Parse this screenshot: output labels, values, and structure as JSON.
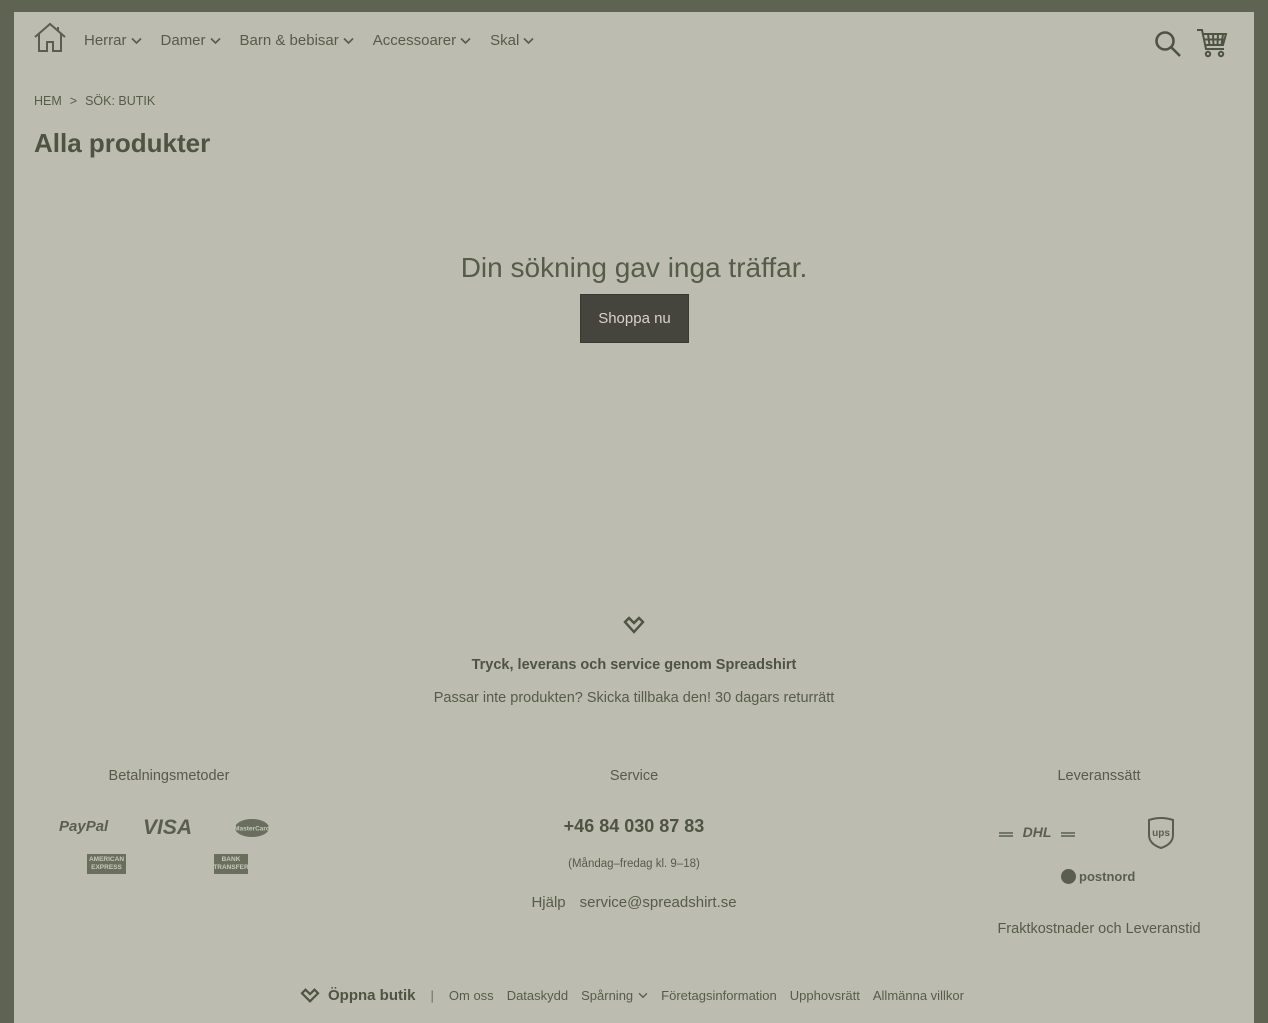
{
  "header": {
    "nav": [
      {
        "label": "Herrar"
      },
      {
        "label": "Damer"
      },
      {
        "label": "Barn & bebisar"
      },
      {
        "label": "Accessoarer"
      },
      {
        "label": "Skal"
      }
    ],
    "icons": [
      "home-icon",
      "search-icon",
      "cart-icon"
    ]
  },
  "breadcrumb": {
    "home": "HEM",
    "separator": ">",
    "current": "SÖK: BUTIK"
  },
  "page_title": "Alla produkter",
  "results": {
    "message": "Din sökning gav inga träffar.",
    "button": "Shoppa nu"
  },
  "promo": {
    "tagline": "Tryck, leverans och service genom Spreadshirt",
    "returns": "Passar inte produkten? Skicka tillbaka den! 30 dagars returrätt"
  },
  "footer": {
    "payments": {
      "title": "Betalningsmetoder",
      "paypal": "PayPal",
      "visa": "VISA",
      "mastercard": "MasterCard",
      "amex_line1": "AMERICAN",
      "amex_line2": "EXPRESS",
      "bank_line1": "BANK",
      "bank_line2": "TRANSFER"
    },
    "service": {
      "title": "Service",
      "phone": "+46 84 030 87 83",
      "hours": "(Måndag–fredag kl. 9–18)",
      "help": "Hjälp",
      "email": "service@spreadshirt.se"
    },
    "delivery": {
      "title": "Leveranssätt",
      "dhl": "DHL",
      "ups": "ups",
      "postnord": "postnord",
      "shipping_link": "Fraktkostnader och Leveranstid"
    },
    "bar": {
      "open_shop": "Öppna butik",
      "separator": "|",
      "links": [
        "Om oss",
        "Dataskydd",
        "Spårning",
        "Företagsinformation",
        "Upphovsrätt",
        "Allmänna villkor"
      ]
    }
  },
  "colors": {
    "page_bg": "#bcbdb0",
    "frame": "#5e6451",
    "button_bg": "#45443d",
    "text": "#4e5344"
  }
}
